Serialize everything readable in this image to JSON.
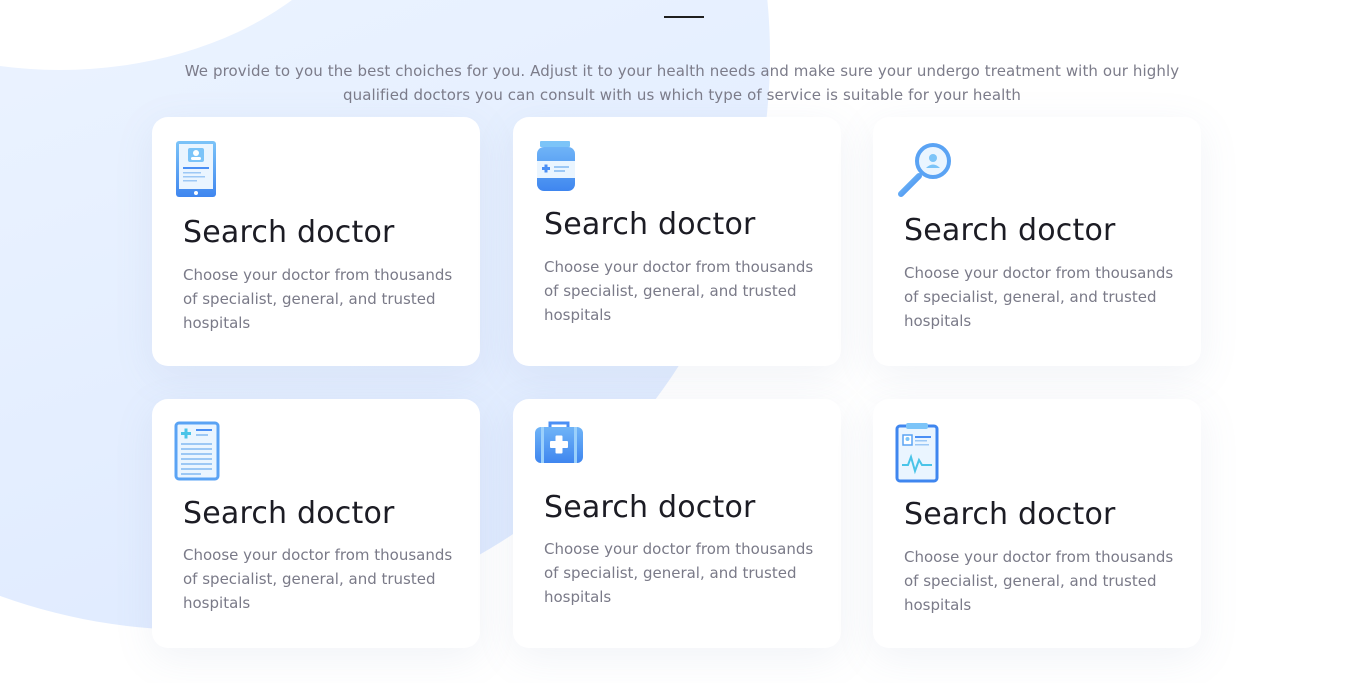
{
  "intro": {
    "text": "We provide to you the best choiches for you. Adjust it to your health needs and make sure your undergo treatment with our highly qualified doctors you can consult with us which type of service is suitable for your health"
  },
  "colors": {
    "accent": "#4a8ff5",
    "accent_light": "#8ec3f7",
    "title": "#1c1c24",
    "body_text": "#7a7a88"
  },
  "cards": [
    {
      "icon": "tablet-profile-icon",
      "title": "Search doctor",
      "description": "Choose your doctor from thousands of specialist, general, and trusted hospitals"
    },
    {
      "icon": "medicine-bottle-icon",
      "title": "Search doctor",
      "description": "Choose your doctor from thousands of specialist, general, and trusted hospitals"
    },
    {
      "icon": "magnifier-user-icon",
      "title": "Search doctor",
      "description": "Choose your doctor from thousands of specialist, general, and trusted hospitals"
    },
    {
      "icon": "medical-document-icon",
      "title": "Search doctor",
      "description": "Choose your doctor from thousands of specialist, general, and trusted hospitals"
    },
    {
      "icon": "first-aid-kit-icon",
      "title": "Search doctor",
      "description": "Choose your doctor from thousands of specialist, general, and trusted hospitals"
    },
    {
      "icon": "clipboard-report-icon",
      "title": "Search doctor",
      "description": "Choose your doctor from thousands of specialist, general, and trusted hospitals"
    }
  ]
}
